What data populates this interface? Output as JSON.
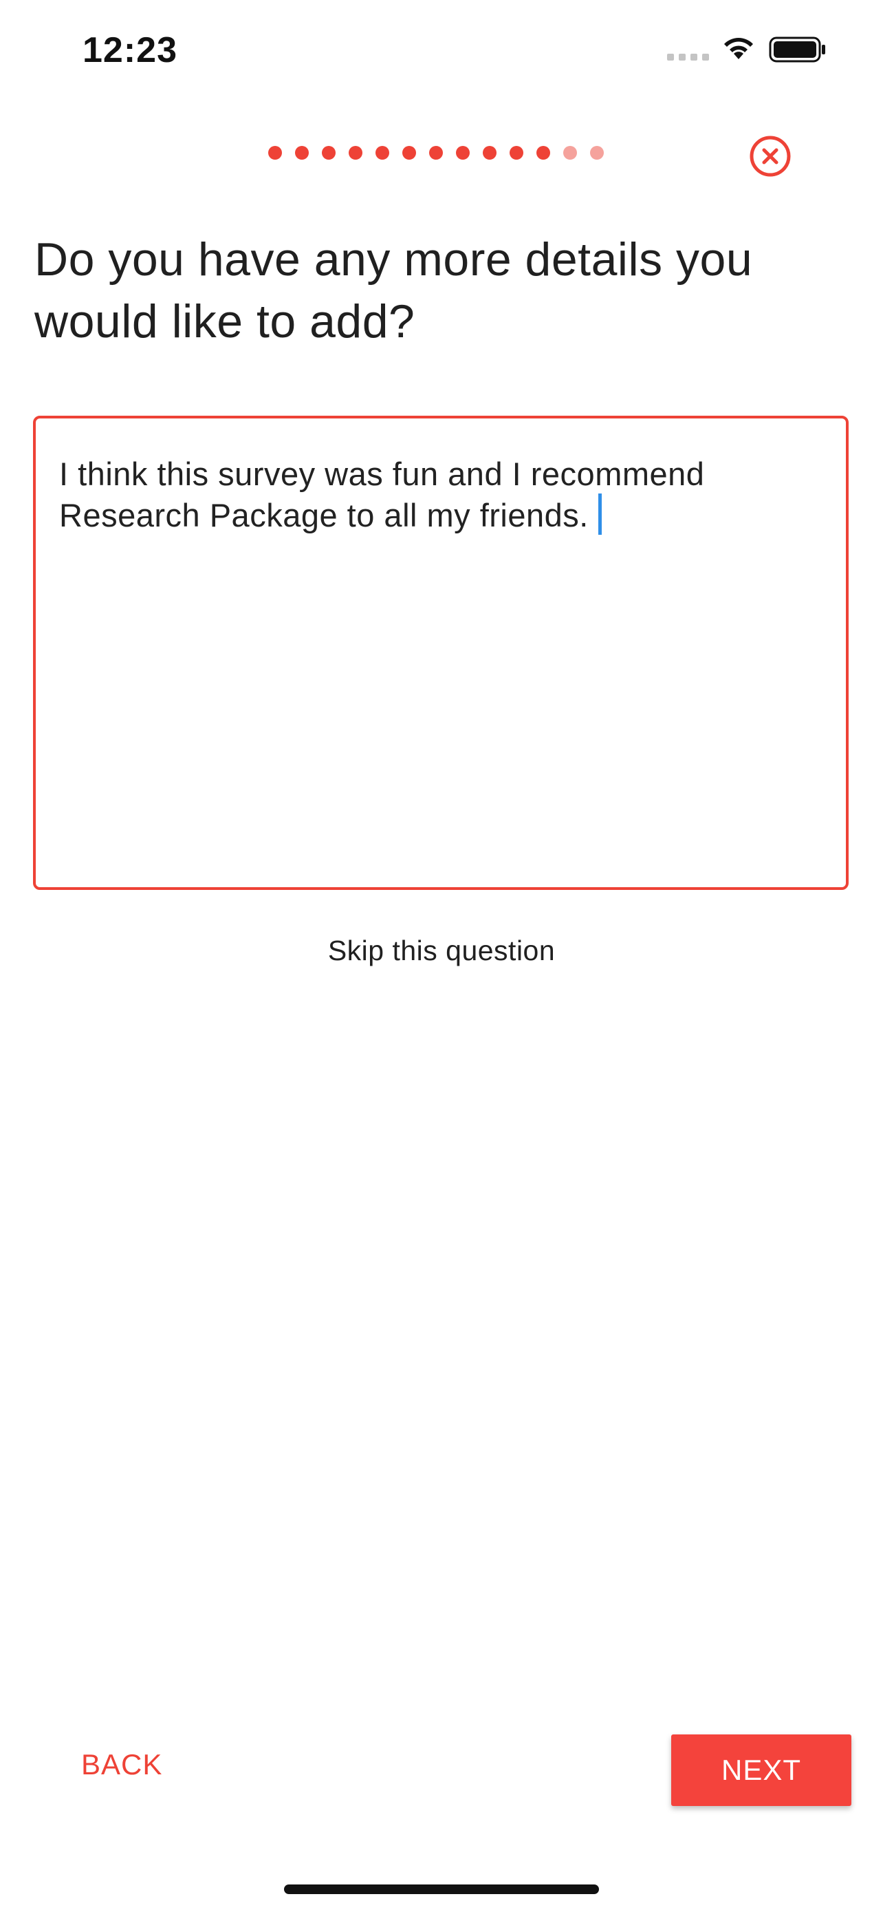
{
  "status_bar": {
    "time": "12:23",
    "icons": [
      "cellular-signal-icon",
      "wifi-icon",
      "battery-icon"
    ]
  },
  "progress": {
    "total_steps": 13,
    "completed_steps": 11,
    "active_color": "#ee4236",
    "inactive_color": "#f5a29c"
  },
  "close_icon": "close-circle-icon",
  "question": {
    "text": "Do you have any more details you would like to add?"
  },
  "answer": {
    "value": "I think this survey was fun and I recommend Research Package to all my friends."
  },
  "skip": {
    "label": "Skip this question"
  },
  "navigation": {
    "back_label": "BACK",
    "next_label": "NEXT"
  },
  "colors": {
    "accent": "#ee4236",
    "next_button": "#f4433c",
    "cursor": "#2f8fe8",
    "text": "#222222"
  }
}
